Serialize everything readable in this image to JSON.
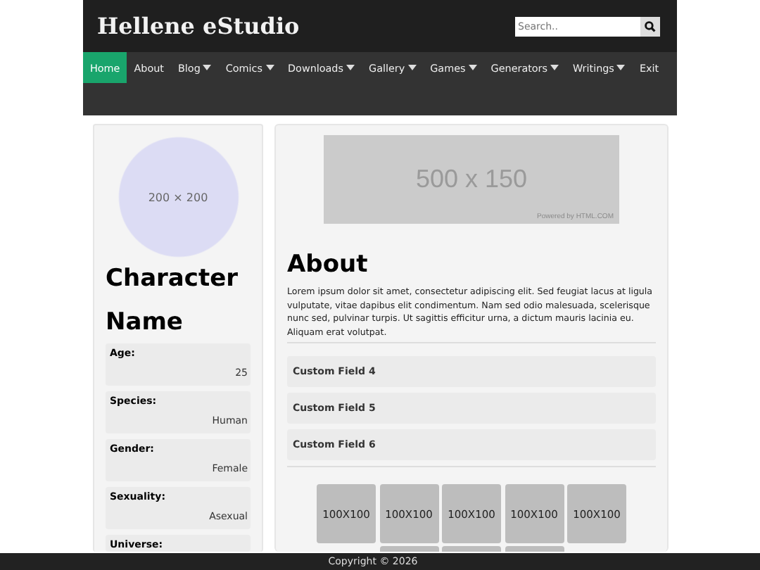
{
  "site": {
    "title": "Hellene eStudio"
  },
  "search": {
    "placeholder": "Search.."
  },
  "nav": {
    "fixed": [
      {
        "label": "Home",
        "selected": true,
        "dropdown": false
      },
      {
        "label": "About",
        "selected": false,
        "dropdown": false
      }
    ],
    "items": [
      {
        "label": "Blog",
        "selected": false,
        "dropdown": true
      },
      {
        "label": "Comics",
        "selected": false,
        "dropdown": true
      },
      {
        "label": "Downloads",
        "selected": false,
        "dropdown": true
      },
      {
        "label": "Gallery",
        "selected": false,
        "dropdown": true
      },
      {
        "label": "Games",
        "selected": false,
        "dropdown": true
      },
      {
        "label": "Generators",
        "selected": false,
        "dropdown": true
      },
      {
        "label": "Writings",
        "selected": false,
        "dropdown": true
      },
      {
        "label": "Exit",
        "selected": false,
        "dropdown": false
      }
    ]
  },
  "profile": {
    "avatar_label": "200 × 200",
    "name": "Character Name",
    "fields": [
      {
        "label": "Age:",
        "value": "25"
      },
      {
        "label": "Species:",
        "value": "Human"
      },
      {
        "label": "Gender:",
        "value": "Female"
      },
      {
        "label": "Sexuality:",
        "value": "Asexual"
      },
      {
        "label": "Universe:",
        "covered": true
      }
    ]
  },
  "main": {
    "banner": {
      "label": "500 x 150",
      "credit": "Powered by HTML.COM"
    },
    "heading": "About",
    "text": "Lorem ipsum dolor sit amet, consectetur adipiscing elit. Sed feugiat lacus at ligula vulputate, vitae dapibus elit condimentum. Nam sed odio malesuada, scelerisque nunc sed, pulvinar turpis. Ut sagittis efficitur urna, a dictum mauris lacinia eu. Aliquam erat volutpat.",
    "custom_fields": [
      "Custom Field 4",
      "Custom Field 5",
      "Custom Field 6"
    ],
    "gallery": [
      {
        "label": "100X100"
      },
      {
        "label": "100X100"
      },
      {
        "label": "100X100"
      },
      {
        "label": "100X100"
      },
      {
        "label": "100X100"
      },
      {
        "covered": true
      },
      {
        "covered": true
      },
      {
        "covered": true
      }
    ]
  },
  "footer": {
    "text": "Copyright © 2026"
  }
}
